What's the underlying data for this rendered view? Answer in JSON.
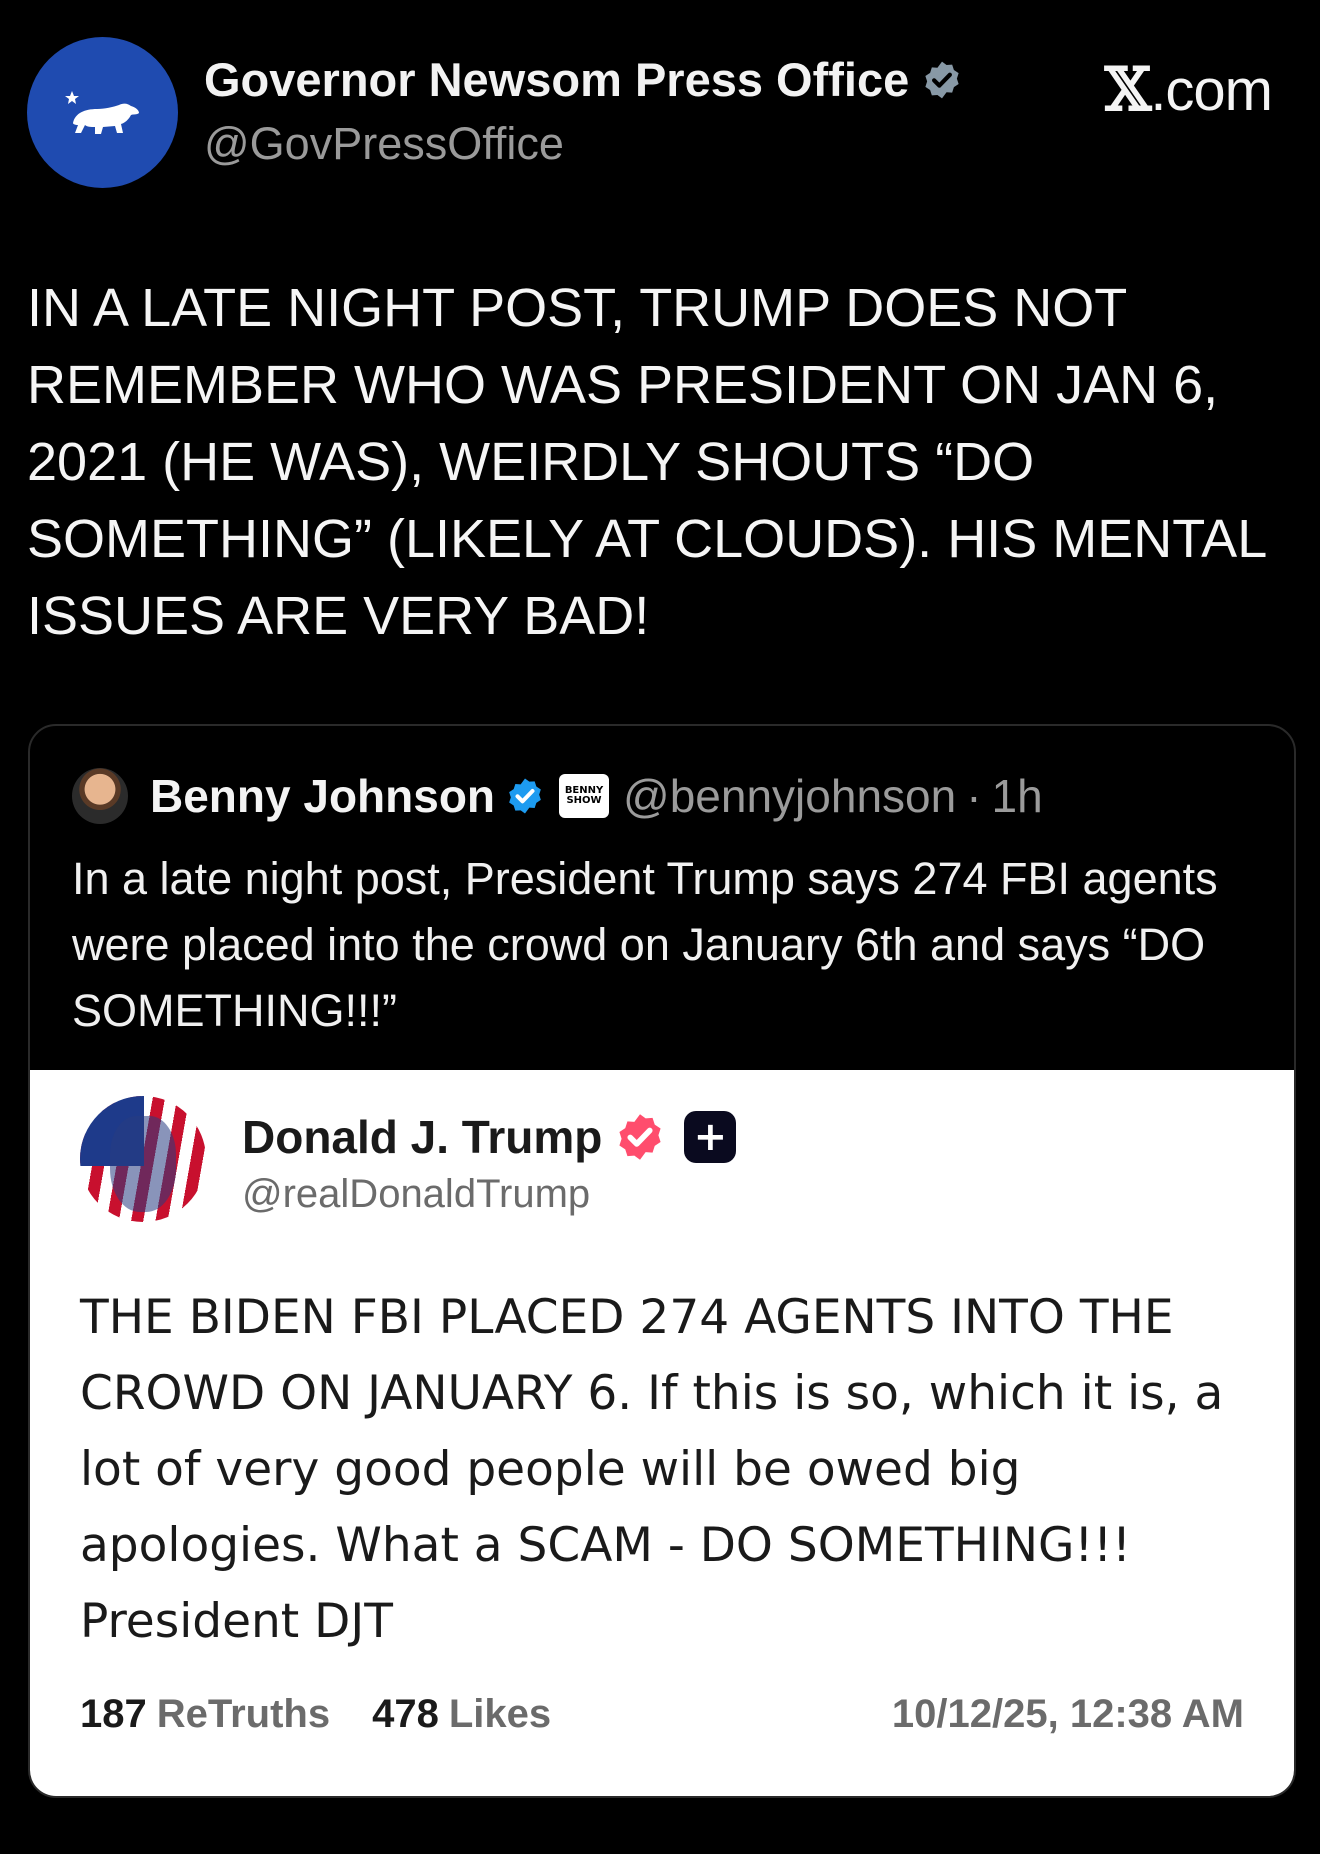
{
  "post": {
    "author_name": "Governor Newsom Press Office",
    "author_handle": "@GovPressOffice",
    "site_label": ".com",
    "site_glyph": "𝕏",
    "text": "IN A LATE NIGHT POST, TRUMP DOES NOT REMEMBER WHO WAS PRESIDENT ON JAN 6, 2021 (HE WAS), WEIRDLY SHOUTS “DO SOMETHING” (LIKELY AT CLOUDS). HIS MENTAL ISSUES ARE VERY BAD!",
    "verified_badge_color": "#8899a6",
    "avatar_color": "#1f4bb0"
  },
  "quote": {
    "author_name": "Benny Johnson",
    "badge_text_line1": "BENNY",
    "badge_text_line2": "SHOW",
    "author_handle": "@bennyjohnson",
    "separator": "·",
    "age": "1h",
    "text": "In a late night post, President Trump says 274 FBI agents were placed into the crowd on January 6th and says “DO SOMETHING!!!”",
    "verified_badge_color": "#1d9bf0"
  },
  "truth": {
    "author_name": "Donald J. Trump",
    "author_handle": "@realDonaldTrump",
    "plus_badge": "+",
    "verified_badge_color": "#ff4d6d",
    "text": "THE BIDEN FBI PLACED 274 AGENTS INTO THE CROWD ON JANUARY 6. If this is so, which it is, a lot of very good people will be owed big apologies. What a SCAM - DO SOMETHING!!! President DJT",
    "retruths_count": "187",
    "retruths_label": "ReTruths",
    "likes_count": "478",
    "likes_label": "Likes",
    "timestamp": "10/12/25, 12:38 AM"
  }
}
